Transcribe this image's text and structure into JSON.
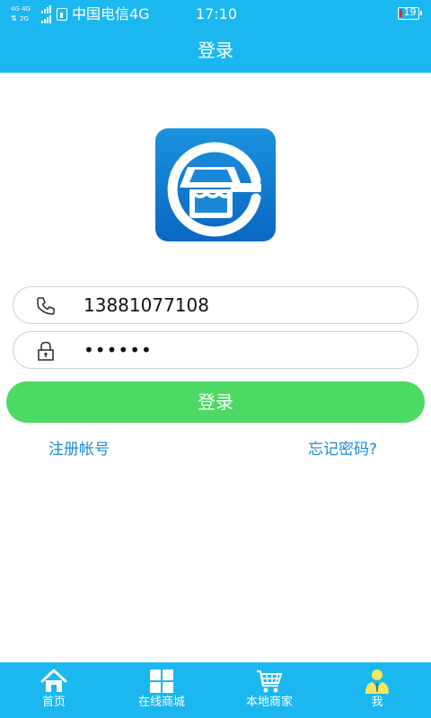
{
  "status_bar": {
    "network_top": "4G 4G",
    "network_bottom": "2G",
    "carrier": "中国电信4G",
    "time": "17:10",
    "battery": "19"
  },
  "header": {
    "title": "登录"
  },
  "login_form": {
    "phone": {
      "value": "13881077108",
      "icon": "phone-icon"
    },
    "password": {
      "value": "••••••",
      "icon": "lock-icon"
    },
    "submit_label": "登录",
    "register_link": "注册帐号",
    "forgot_link": "忘记密码?"
  },
  "bottom_nav": {
    "items": [
      {
        "label": "首页",
        "icon": "home-icon"
      },
      {
        "label": "在线商城",
        "icon": "grid-icon"
      },
      {
        "label": "本地商家",
        "icon": "cart-icon"
      },
      {
        "label": "我",
        "icon": "user-icon"
      }
    ]
  },
  "colors": {
    "primary": "#1bb7f1",
    "button": "#4cd964",
    "link": "#1a8bd6",
    "user_icon": "#f5e65a"
  }
}
